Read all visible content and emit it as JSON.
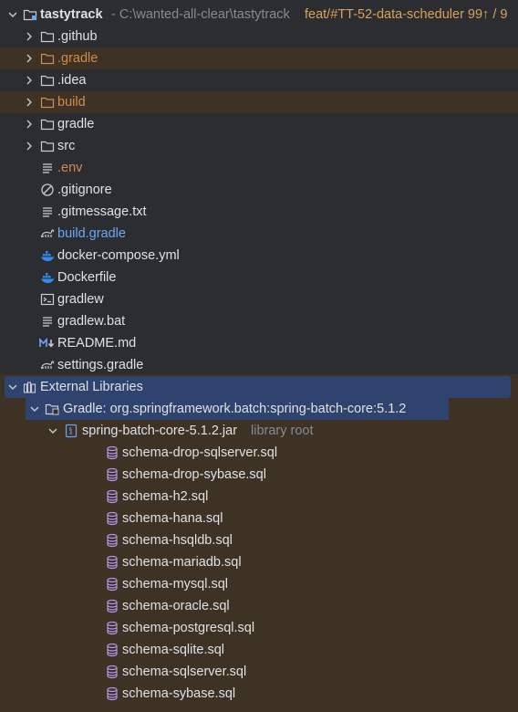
{
  "project": {
    "name": "tastytrack",
    "path": "- C:\\wanted-all-clear\\tastytrack",
    "branch": "feat/#TT-52-data-scheduler 99↑ / 9"
  },
  "items": {
    "github": ".github",
    "gradle_dot": ".gradle",
    "idea": ".idea",
    "build": "build",
    "gradle": "gradle",
    "src": "src",
    "env": ".env",
    "gitignore": ".gitignore",
    "gitmessage": ".gitmessage.txt",
    "build_gradle": "build.gradle",
    "docker_compose": "docker-compose.yml",
    "dockerfile": "Dockerfile",
    "gradlew": "gradlew",
    "gradlew_bat": "gradlew.bat",
    "readme": "README.md",
    "settings_gradle": "settings.gradle"
  },
  "external": {
    "label": "External Libraries",
    "library": "Gradle: org.springframework.batch:spring-batch-core:5.1.2",
    "jar": "spring-batch-core-5.1.2.jar",
    "jar_suffix": "library root",
    "sql_files": [
      "schema-drop-sqlserver.sql",
      "schema-drop-sybase.sql",
      "schema-h2.sql",
      "schema-hana.sql",
      "schema-hsqldb.sql",
      "schema-mariadb.sql",
      "schema-mysql.sql",
      "schema-oracle.sql",
      "schema-postgresql.sql",
      "schema-sqlite.sql",
      "schema-sqlserver.sql",
      "schema-sybase.sql"
    ]
  },
  "icons": {
    "chevron": "chevron-icon",
    "folder": "folder-icon",
    "file": "text-file-icon",
    "ignore": "ignore-file-icon",
    "gradle": "gradle-icon",
    "docker": "docker-icon",
    "terminal": "terminal-icon",
    "markdown": "markdown-icon",
    "library": "library-icon",
    "jar": "jar-icon",
    "sql": "database-icon"
  },
  "colors": {
    "background": "#2b2d30",
    "excluded": "#3d3223",
    "selection": "#2e436e",
    "text": "#dfe1e5",
    "orange": "#d28b4e",
    "blue": "#6ea6f7",
    "grey": "#868a91",
    "docker": "#2f8cf0",
    "sql": "#b493e8"
  }
}
